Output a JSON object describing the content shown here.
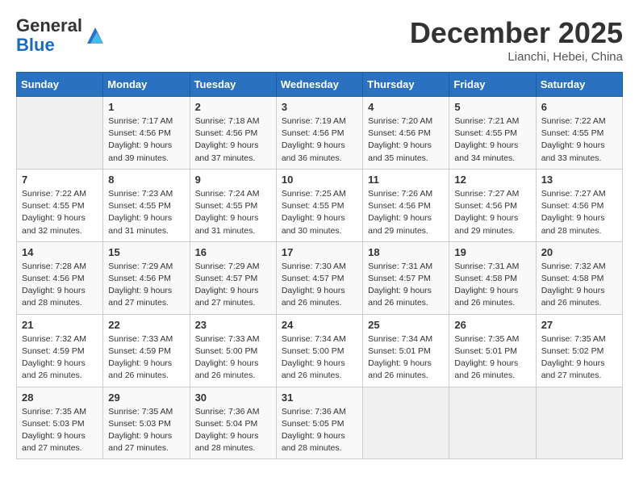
{
  "header": {
    "logo_line1": "General",
    "logo_line2": "Blue",
    "month": "December 2025",
    "location": "Lianchi, Hebei, China"
  },
  "weekdays": [
    "Sunday",
    "Monday",
    "Tuesday",
    "Wednesday",
    "Thursday",
    "Friday",
    "Saturday"
  ],
  "weeks": [
    [
      {
        "day": "",
        "info": ""
      },
      {
        "day": "1",
        "info": "Sunrise: 7:17 AM\nSunset: 4:56 PM\nDaylight: 9 hours\nand 39 minutes."
      },
      {
        "day": "2",
        "info": "Sunrise: 7:18 AM\nSunset: 4:56 PM\nDaylight: 9 hours\nand 37 minutes."
      },
      {
        "day": "3",
        "info": "Sunrise: 7:19 AM\nSunset: 4:56 PM\nDaylight: 9 hours\nand 36 minutes."
      },
      {
        "day": "4",
        "info": "Sunrise: 7:20 AM\nSunset: 4:56 PM\nDaylight: 9 hours\nand 35 minutes."
      },
      {
        "day": "5",
        "info": "Sunrise: 7:21 AM\nSunset: 4:55 PM\nDaylight: 9 hours\nand 34 minutes."
      },
      {
        "day": "6",
        "info": "Sunrise: 7:22 AM\nSunset: 4:55 PM\nDaylight: 9 hours\nand 33 minutes."
      }
    ],
    [
      {
        "day": "7",
        "info": "Sunrise: 7:22 AM\nSunset: 4:55 PM\nDaylight: 9 hours\nand 32 minutes."
      },
      {
        "day": "8",
        "info": "Sunrise: 7:23 AM\nSunset: 4:55 PM\nDaylight: 9 hours\nand 31 minutes."
      },
      {
        "day": "9",
        "info": "Sunrise: 7:24 AM\nSunset: 4:55 PM\nDaylight: 9 hours\nand 31 minutes."
      },
      {
        "day": "10",
        "info": "Sunrise: 7:25 AM\nSunset: 4:55 PM\nDaylight: 9 hours\nand 30 minutes."
      },
      {
        "day": "11",
        "info": "Sunrise: 7:26 AM\nSunset: 4:56 PM\nDaylight: 9 hours\nand 29 minutes."
      },
      {
        "day": "12",
        "info": "Sunrise: 7:27 AM\nSunset: 4:56 PM\nDaylight: 9 hours\nand 29 minutes."
      },
      {
        "day": "13",
        "info": "Sunrise: 7:27 AM\nSunset: 4:56 PM\nDaylight: 9 hours\nand 28 minutes."
      }
    ],
    [
      {
        "day": "14",
        "info": "Sunrise: 7:28 AM\nSunset: 4:56 PM\nDaylight: 9 hours\nand 28 minutes."
      },
      {
        "day": "15",
        "info": "Sunrise: 7:29 AM\nSunset: 4:56 PM\nDaylight: 9 hours\nand 27 minutes."
      },
      {
        "day": "16",
        "info": "Sunrise: 7:29 AM\nSunset: 4:57 PM\nDaylight: 9 hours\nand 27 minutes."
      },
      {
        "day": "17",
        "info": "Sunrise: 7:30 AM\nSunset: 4:57 PM\nDaylight: 9 hours\nand 26 minutes."
      },
      {
        "day": "18",
        "info": "Sunrise: 7:31 AM\nSunset: 4:57 PM\nDaylight: 9 hours\nand 26 minutes."
      },
      {
        "day": "19",
        "info": "Sunrise: 7:31 AM\nSunset: 4:58 PM\nDaylight: 9 hours\nand 26 minutes."
      },
      {
        "day": "20",
        "info": "Sunrise: 7:32 AM\nSunset: 4:58 PM\nDaylight: 9 hours\nand 26 minutes."
      }
    ],
    [
      {
        "day": "21",
        "info": "Sunrise: 7:32 AM\nSunset: 4:59 PM\nDaylight: 9 hours\nand 26 minutes."
      },
      {
        "day": "22",
        "info": "Sunrise: 7:33 AM\nSunset: 4:59 PM\nDaylight: 9 hours\nand 26 minutes."
      },
      {
        "day": "23",
        "info": "Sunrise: 7:33 AM\nSunset: 5:00 PM\nDaylight: 9 hours\nand 26 minutes."
      },
      {
        "day": "24",
        "info": "Sunrise: 7:34 AM\nSunset: 5:00 PM\nDaylight: 9 hours\nand 26 minutes."
      },
      {
        "day": "25",
        "info": "Sunrise: 7:34 AM\nSunset: 5:01 PM\nDaylight: 9 hours\nand 26 minutes."
      },
      {
        "day": "26",
        "info": "Sunrise: 7:35 AM\nSunset: 5:01 PM\nDaylight: 9 hours\nand 26 minutes."
      },
      {
        "day": "27",
        "info": "Sunrise: 7:35 AM\nSunset: 5:02 PM\nDaylight: 9 hours\nand 27 minutes."
      }
    ],
    [
      {
        "day": "28",
        "info": "Sunrise: 7:35 AM\nSunset: 5:03 PM\nDaylight: 9 hours\nand 27 minutes."
      },
      {
        "day": "29",
        "info": "Sunrise: 7:35 AM\nSunset: 5:03 PM\nDaylight: 9 hours\nand 27 minutes."
      },
      {
        "day": "30",
        "info": "Sunrise: 7:36 AM\nSunset: 5:04 PM\nDaylight: 9 hours\nand 28 minutes."
      },
      {
        "day": "31",
        "info": "Sunrise: 7:36 AM\nSunset: 5:05 PM\nDaylight: 9 hours\nand 28 minutes."
      },
      {
        "day": "",
        "info": ""
      },
      {
        "day": "",
        "info": ""
      },
      {
        "day": "",
        "info": ""
      }
    ]
  ]
}
